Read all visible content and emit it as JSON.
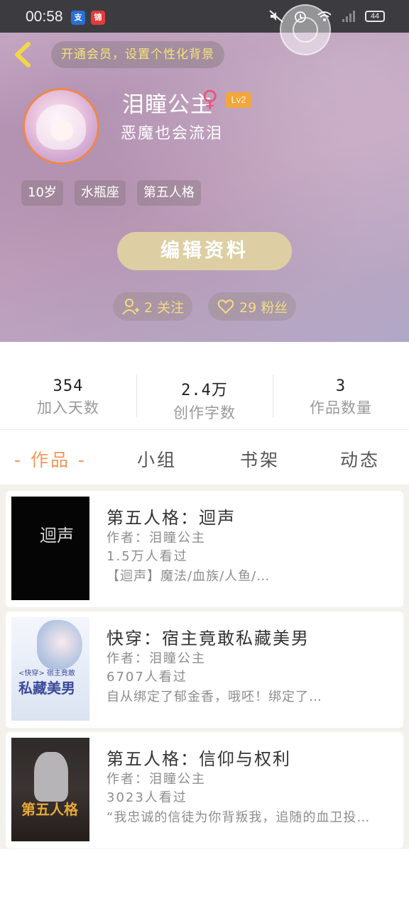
{
  "status_bar": {
    "time": "00:58",
    "app_icon_1": "支",
    "app_icon_2": "锦",
    "battery": "44"
  },
  "header": {
    "vip_banner": "开通会员，设置个性化背景",
    "username": "泪瞳公主",
    "gender_symbol": "♀",
    "level": "Lv2",
    "signature": "恶魔也会流泪",
    "tags": [
      "10岁",
      "水瓶座",
      "第五人格"
    ],
    "edit_button": "编辑资料",
    "following_label": "2 关注",
    "followers_label": "29 粉丝"
  },
  "stats": [
    {
      "value": "354",
      "label": "加入天数"
    },
    {
      "value": "2.4万",
      "label": "创作字数"
    },
    {
      "value": "3",
      "label": "作品数量"
    }
  ],
  "tabs": [
    "- 作品 -",
    "小组",
    "书架",
    "动态"
  ],
  "active_tab": "- 作品 -",
  "books": [
    {
      "title": "第五人格：迴声",
      "author": "作者：泪瞳公主",
      "views": "1.5万人看过",
      "desc": "【迴声】魔法/血族/人鱼/…",
      "cover_text": "迴声"
    },
    {
      "title": "快穿：宿主竟敢私藏美男",
      "author": "作者：泪瞳公主",
      "views": "6707人看过",
      "desc": "自从绑定了郁金香，哦呸！绑定了…",
      "cover_text": "私藏美男",
      "cover_subtext": "<快穿> 宿主竟敢"
    },
    {
      "title": "第五人格：信仰与权利",
      "author": "作者：泪瞳公主",
      "views": "3023人看过",
      "desc": "“我忠诚的信徒为你背叛我，追随的血卫投…",
      "cover_text": "第五人格"
    }
  ],
  "colors": {
    "accent_orange": "#f0975c",
    "gold_text": "#f4dd7e",
    "level_badge": "#f2a63c",
    "edit_button_bg": "#ddcfa3"
  }
}
